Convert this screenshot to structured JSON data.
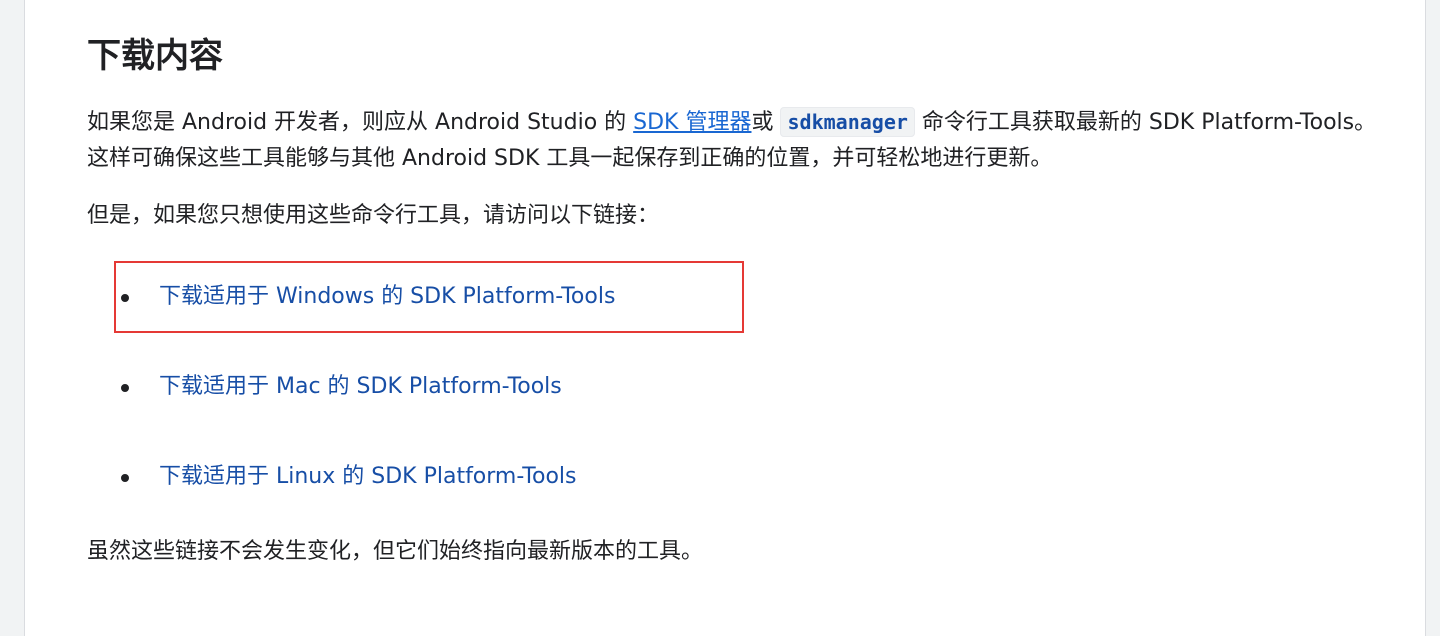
{
  "section": {
    "title": "下载内容"
  },
  "intro": {
    "part1": "如果您是 Android 开发者，则应从 Android Studio 的 ",
    "sdk_manager_link": "SDK 管理器",
    "part2": "或 ",
    "command": "sdkmanager",
    "part3": " 命令行工具获取最新的 SDK Platform-Tools。这样可确保这些工具能够与其他 Android SDK 工具一起保存到正确的位置，并可轻松地进行更新。"
  },
  "note": "但是，如果您只想使用这些命令行工具，请访问以下链接：",
  "downloads": [
    {
      "label": "下载适用于 Windows 的 SDK Platform-Tools"
    },
    {
      "label": "下载适用于 Mac 的 SDK Platform-Tools"
    },
    {
      "label": "下载适用于 Linux 的 SDK Platform-Tools"
    }
  ],
  "footer_note": "虽然这些链接不会发生变化，但它们始终指向最新版本的工具。",
  "colors": {
    "link": "#174ea6",
    "text": "#202124",
    "highlight": "#e53935"
  }
}
